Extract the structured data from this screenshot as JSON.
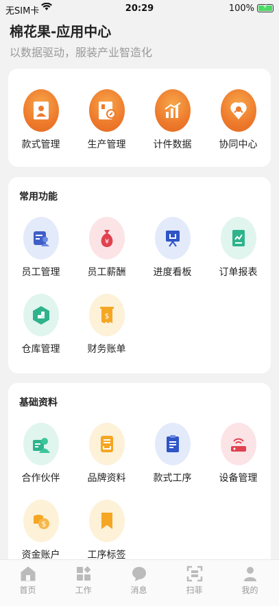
{
  "status": {
    "carrier": "无SIM卡",
    "time": "20:29",
    "battery": "100%"
  },
  "header": {
    "title": "棉花果-应用中心",
    "subtitle": "以数据驱动，服装产业智造化"
  },
  "main_apps": [
    {
      "label": "款式管理",
      "icon": "style-manage-icon"
    },
    {
      "label": "生产管理",
      "icon": "production-manage-icon"
    },
    {
      "label": "计件数据",
      "icon": "piecework-data-icon"
    },
    {
      "label": "协同中心",
      "icon": "collaboration-center-icon"
    }
  ],
  "common": {
    "title": "常用功能",
    "items": [
      {
        "label": "员工管理",
        "icon": "employee-manage-icon"
      },
      {
        "label": "员工薪酬",
        "icon": "employee-salary-icon"
      },
      {
        "label": "进度看板",
        "icon": "progress-board-icon"
      },
      {
        "label": "订单报表",
        "icon": "order-report-icon"
      },
      {
        "label": "仓库管理",
        "icon": "warehouse-manage-icon"
      },
      {
        "label": "财务账单",
        "icon": "finance-bill-icon"
      }
    ]
  },
  "basic": {
    "title": "基础资料",
    "items": [
      {
        "label": "合作伙伴",
        "icon": "partner-icon"
      },
      {
        "label": "品牌资料",
        "icon": "brand-info-icon"
      },
      {
        "label": "款式工序",
        "icon": "style-process-icon"
      },
      {
        "label": "设备管理",
        "icon": "device-manage-icon"
      },
      {
        "label": "资金账户",
        "icon": "fund-account-icon"
      },
      {
        "label": "工序标签",
        "icon": "process-tag-icon"
      }
    ]
  },
  "tabs": [
    {
      "label": "首页",
      "icon": "home-icon"
    },
    {
      "label": "工作",
      "icon": "work-icon"
    },
    {
      "label": "消息",
      "icon": "message-icon"
    },
    {
      "label": "扫菲",
      "icon": "scan-icon"
    },
    {
      "label": "我的",
      "icon": "profile-icon"
    }
  ],
  "colors": {
    "accent": "#ee7a2c",
    "background": "#f2f2f2",
    "card": "#ffffff"
  }
}
